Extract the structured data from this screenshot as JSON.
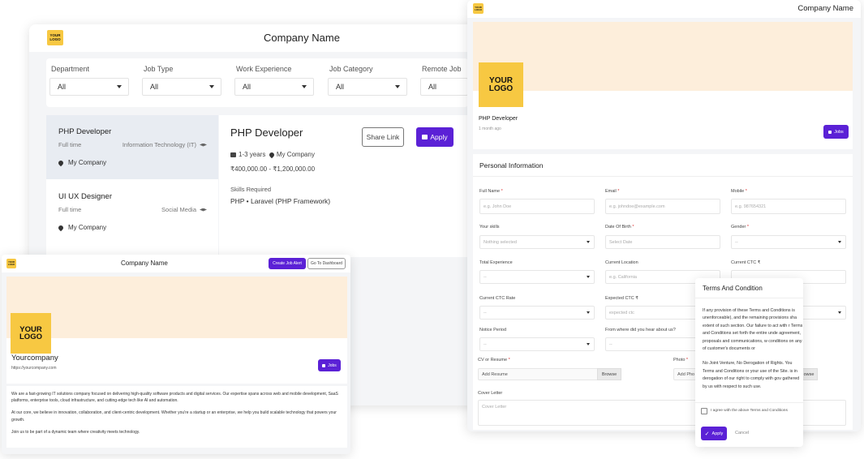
{
  "back_window": {
    "logo_text": "YOUR LOGO",
    "title": "Company Name",
    "filters": [
      {
        "label": "Department",
        "value": "All"
      },
      {
        "label": "Job Type",
        "value": "All"
      },
      {
        "label": "Work Experience",
        "value": "All"
      },
      {
        "label": "Job Category",
        "value": "All"
      },
      {
        "label": "Remote Job",
        "value": "All"
      }
    ],
    "jobs": [
      {
        "title": "PHP Developer",
        "type": "Full time",
        "category": "Information Technology (IT)",
        "company": "My Company"
      },
      {
        "title": "UI UX Designer",
        "type": "Full time",
        "category": "Social Media",
        "company": "My Company"
      }
    ],
    "detail": {
      "title": "PHP Developer",
      "share_label": "Share Link",
      "apply_label": "Apply",
      "experience": "1-3 years",
      "company": "My Company",
      "salary": "₹400,000.00 - ₹1,200,000.00",
      "skills_heading": "Skills Required",
      "skills": "PHP • Laravel (PHP Framework)"
    }
  },
  "company_window": {
    "logo_text": "YOUR LOGO",
    "title": "Company Name",
    "create_alert_label": "Create Job Alert",
    "dashboard_label": "Go To Dashboard",
    "big_logo_text": "YOUR LOGO",
    "company_name": "Yourcompany",
    "company_url": "https://yourcompany.com",
    "jobs_label": "Jobs",
    "about": [
      "We are a fast-growing IT solutions company focused on delivering high-quality software products and digital services. Our expertise spans across web and mobile development, SaaS platforms, enterprise tools, cloud infrastructure, and cutting-edge tech like AI and automation.",
      "At our core, we believe in innovation, collaboration, and client-centric development. Whether you're a startup or an enterprise, we help you build scalable technology that powers your growth.",
      "Join us to be part of a dynamic team where creativity meets technology."
    ]
  },
  "apply_window": {
    "logo_text": "YOUR LOGO",
    "title": "Company Name",
    "big_logo_text": "YOUR LOGO",
    "job_title": "PHP Developer",
    "posted": "1 month ago",
    "jobs_label": "Jobs",
    "section_title": "Personal Information",
    "fields": {
      "full_name": {
        "label": "Full Name",
        "placeholder": "e.g. John Doe"
      },
      "email": {
        "label": "Email",
        "placeholder": "e.g. johndoe@example.com"
      },
      "mobile": {
        "label": "Mobile",
        "placeholder": "e.g. 987654321"
      },
      "skills": {
        "label": "Your skills",
        "value": "Nothing selected"
      },
      "dob": {
        "label": "Date Of Birth",
        "placeholder": "Select Date"
      },
      "gender": {
        "label": "Gender",
        "value": "--"
      },
      "total_exp": {
        "label": "Total Experience",
        "value": "--"
      },
      "location": {
        "label": "Current Location",
        "placeholder": "e.g. California"
      },
      "ctc": {
        "label": "Current CTC ₹"
      },
      "ctc_rate": {
        "label": "Current CTC Rate",
        "value": "--"
      },
      "expected_ctc": {
        "label": "Expected CTC ₹",
        "placeholder": "expected ctc"
      },
      "notice": {
        "label": "Notice Period",
        "value": "--"
      },
      "heard": {
        "label": "From where did you hear about us?",
        "value": "--"
      },
      "cv": {
        "label": "CV or Resume",
        "placeholder": "Add Resume",
        "browse": "Browse"
      },
      "photo": {
        "label": "Photo",
        "placeholder": "Add Pho",
        "browse": "owse"
      },
      "cover": {
        "label": "Cover Letter",
        "placeholder": "Cover Letter"
      }
    }
  },
  "terms_modal": {
    "title": "Terms And Condition",
    "paragraphs": [
      "If any provision of these Terms and Conditions is unenforceable), and the remaining provisions sha extent of such section. Our failure to act with r Terms and Conditions set forth the entire unde agreement, proposals and communications, w conditions on any of customer's documents or",
      "No Joint Venture, No Derogation of Rights. You Terms and Conditions or your use of the Site. is in derogation of our right to comply with gov gathered by us with respect to such use."
    ],
    "agree_label": "I agree with the above Terms and Conditions",
    "apply_label": "Apply",
    "cancel_label": "Cancel"
  },
  "colors": {
    "accent": "#5b21d6",
    "logo": "#f7c842",
    "banner": "#fdeedb",
    "selected_row": "#e8ecf2"
  }
}
